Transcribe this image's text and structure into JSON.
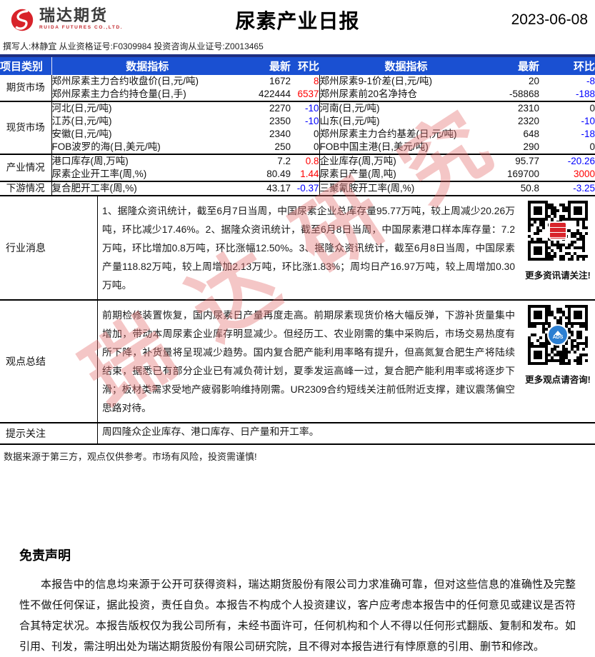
{
  "header": {
    "brand": "瑞达期货",
    "brand_sub": "RUIDA FUTURES CO.,LTD.",
    "title": "尿素产业日报",
    "date": "2023-06-08",
    "author_line": "撰写人:林静宜 从业资格证号:F0309984 投资咨询从业证号:Z0013465"
  },
  "colors": {
    "header_blue": "#1a50d2",
    "up_red": "#ff0000",
    "down_blue": "#0000ff",
    "brand_red": "#d8232a"
  },
  "table": {
    "headers": [
      "项目类别",
      "数据指标",
      "最新",
      "环比",
      "数据指标",
      "最新",
      "环比"
    ],
    "groups": [
      {
        "category": "期货市场",
        "rows": [
          {
            "l": {
              "label": "郑州尿素主力合约收盘价(日,元/吨)",
              "val": "1672",
              "chg": "8",
              "chg_c": "red"
            },
            "r": {
              "label": "郑州尿素9-1价差(日,元/吨)",
              "val": "20",
              "chg": "-8",
              "chg_c": "blue"
            }
          },
          {
            "l": {
              "label": "郑州尿素主力合约持仓量(日,手)",
              "val": "422444",
              "chg": "6537",
              "chg_c": "red"
            },
            "r": {
              "label": "郑州尿素前20名净持仓",
              "val": "-58868",
              "chg": "-188",
              "chg_c": "blue"
            }
          }
        ]
      },
      {
        "category": "现货市场",
        "rows": [
          {
            "l": {
              "label": "河北(日,元/吨)",
              "val": "2270",
              "chg": "-10",
              "chg_c": "blue"
            },
            "r": {
              "label": "河南(日,元/吨)",
              "val": "2310",
              "chg": "0",
              "chg_c": "black"
            }
          },
          {
            "l": {
              "label": "江苏(日,元/吨)",
              "val": "2350",
              "chg": "-10",
              "chg_c": "blue"
            },
            "r": {
              "label": "山东(日,元/吨)",
              "val": "2320",
              "chg": "-10",
              "chg_c": "blue"
            }
          },
          {
            "l": {
              "label": "安徽(日,元/吨)",
              "val": "2340",
              "chg": "0",
              "chg_c": "black"
            },
            "r": {
              "label": "郑州尿素主力合约基差(日,元/吨)",
              "val": "648",
              "chg": "-18",
              "chg_c": "blue"
            }
          },
          {
            "l": {
              "label": "FOB波罗的海(日,美元/吨)",
              "val": "250",
              "chg": "0",
              "chg_c": "black"
            },
            "r": {
              "label": "FOB中国主港(日,美元/吨)",
              "val": "290",
              "chg": "0",
              "chg_c": "black"
            }
          }
        ]
      },
      {
        "category": "产业情况",
        "rows": [
          {
            "l": {
              "label": "港口库存(周,万吨)",
              "val": "7.2",
              "chg": "0.8",
              "chg_c": "red"
            },
            "r": {
              "label": "企业库存(周,万吨)",
              "val": "95.77",
              "chg": "-20.26",
              "chg_c": "blue"
            }
          },
          {
            "l": {
              "label": "尿素企业开工率(周,%)",
              "val": "80.49",
              "chg": "1.44",
              "chg_c": "red"
            },
            "r": {
              "label": "尿素日产量(周,吨)",
              "val": "169700",
              "chg": "3000",
              "chg_c": "red"
            }
          }
        ]
      },
      {
        "category": "下游情况",
        "rows": [
          {
            "l": {
              "label": "复合肥开工率(周,%)",
              "val": "43.17",
              "chg": "-0.37",
              "chg_c": "blue"
            },
            "r": {
              "label": "三聚氰胺开工率(周,%)",
              "val": "50.8",
              "chg": "-3.25",
              "chg_c": "blue"
            }
          }
        ]
      }
    ]
  },
  "sections": [
    {
      "category": "行业消息",
      "text": "1、据隆众资讯统计，截至6月7日当周，中国尿素企业总库存量95.77万吨，较上周减少20.26万吨，环比减少17.46%。2、据隆众资讯统计，截至6月8日当周，中国尿素港口样本库存量：7.2万吨，环比增加0.8万吨，环比涨幅12.50%。3、据隆众资讯统计，截至6月8日当周，中国尿素产量118.82万吨，较上周增加2.13万吨，环比涨1.83%；周均日产16.97万吨，较上周增加0.30万吨。",
      "qr_caption": "更多资讯请关注!",
      "qr_logo": "ruida-red-logo",
      "min_h": 118
    },
    {
      "category": "观点总结",
      "text": "前期检修装置恢复，国内尿素日产量再度走高。前期尿素现货价格大幅反弹，下游补货量集中增加，带动本周尿素企业库存明显减少。但经历工、农业刚需的集中采购后，市场交易热度有所下降，补货量将呈现减少趋势。国内复合肥产能利用率略有提升，但高氮复合肥生产将陆续结束，据悉已有部分企业已有减负荷计划，夏季发运高峰一过，复合肥产能利用率或将逐步下滑；板材类需求受地产疲弱影响维持刚需。UR2309合约短线关注前低附近支撑，建议震荡偏空思路对待。",
      "qr_caption": "更多观点请咨询!",
      "qr_logo": "ads-blue-logo",
      "qr_logo_text": "ADS",
      "min_h": 122
    },
    {
      "category": "提示关注",
      "text": "周四隆众企业库存、港口库存、日产量和开工率。",
      "min_h": 22
    }
  ],
  "footer_note": "数据来源于第三方，观点仅供参考。市场有风险，投资需谨慎!",
  "disclaimer": {
    "title": "免责声明",
    "body": "本报告中的信息均来源于公开可获得资料，瑞达期货股份有限公司力求准确可靠，但对这些信息的准确性及完整性不做任何保证，据此投资，责任自负。本报告不构成个人投资建议，客户应考虑本报告中的任何意见或建议是否符合其特定状况。本报告版权仅为我公司所有，未经书面许可，任何机构和个人不得以任何形式翻版、复制和发布。如引用、刊发，需注明出处为瑞达期货股份有限公司研究院，且不得对本报告进行有悖原意的引用、删节和修改。"
  },
  "watermark": "瑞达研究"
}
